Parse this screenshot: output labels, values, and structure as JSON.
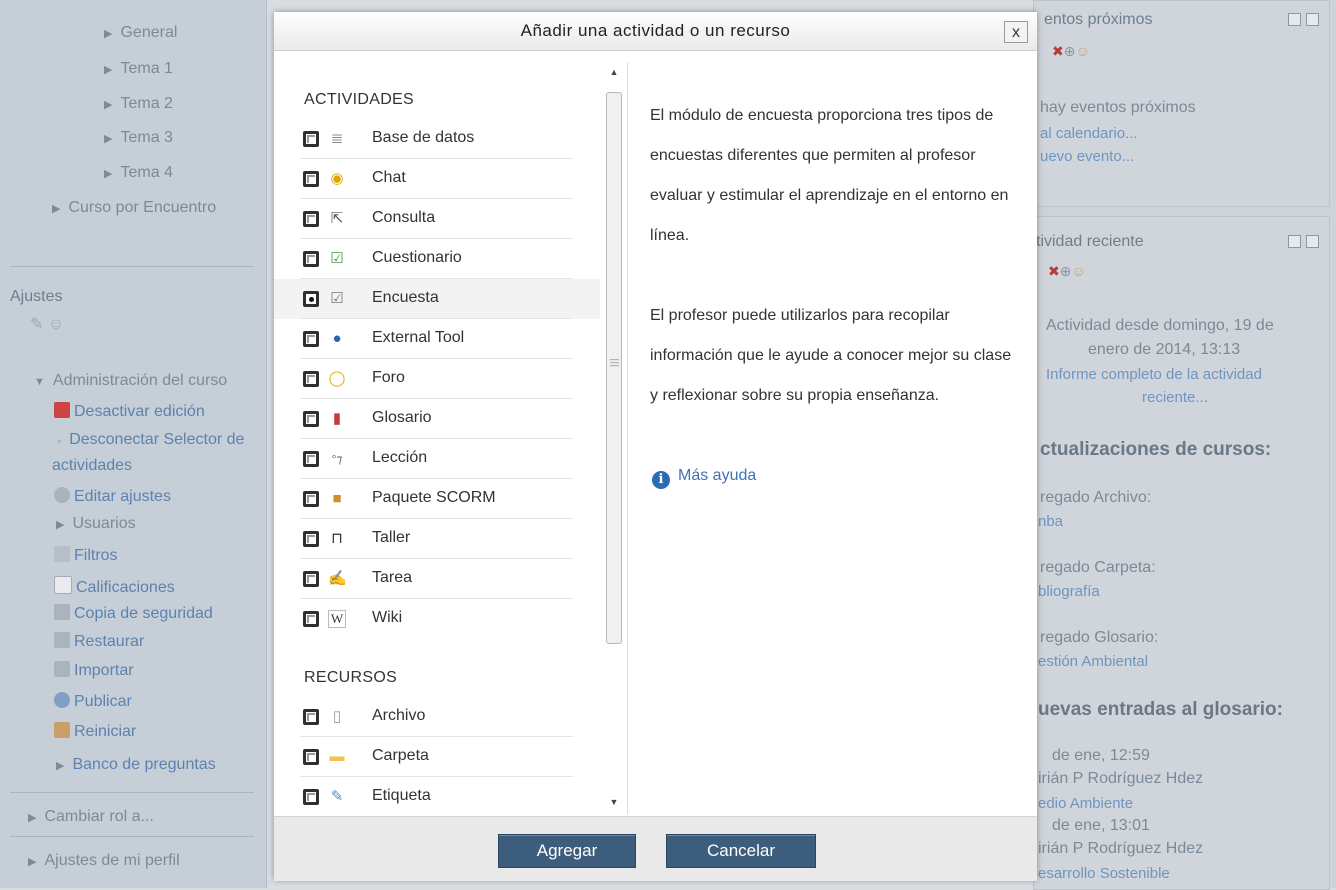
{
  "left": {
    "nav": [
      "General",
      "Tema 1",
      "Tema 2",
      "Tema 3",
      "Tema 4",
      "Curso por Encuentro"
    ],
    "settings_title": "Ajustes",
    "admin_title": "Administración del curso",
    "admin_items": [
      "Desactivar edición",
      "Desconectar Selector de",
      "actividades",
      "Editar ajustes",
      "Usuarios",
      "Filtros",
      "Calificaciones",
      "Copia de seguridad",
      "Restaurar",
      "Importar",
      "Publicar",
      "Reiniciar",
      "Banco de preguntas"
    ],
    "switch_role": "Cambiar rol a...",
    "profile_settings": "Ajustes de mi perfil"
  },
  "right": {
    "events_title": "entos próximos",
    "no_events": "hay eventos próximos",
    "calendar_link": "al calendario...",
    "new_event_link": "uevo evento...",
    "activity_title": "tividad reciente",
    "activity_since_1": "Actividad desde domingo, 19 de",
    "activity_since_2": "enero de 2014, 13:13",
    "report_link_1": "Informe completo de la actividad",
    "report_link_2": "reciente...",
    "updates_heading": "ctualizaciones de cursos:",
    "upd1_label": "regado Archivo:",
    "upd1_link": "nba",
    "upd2_label": "regado Carpeta:",
    "upd2_link": "bliografía",
    "upd3_label": "regado Glosario:",
    "upd3_link": "estión Ambiental",
    "glossary_heading": "uevas entradas al glosario:",
    "g1_date": "de ene, 12:59",
    "g1_author": "irián P Rodríguez Hdez",
    "g1_link": "edio Ambiente",
    "g2_date": "de ene, 13:01",
    "g2_author": "irián P Rodríguez Hdez",
    "g2_link": "esarrollo Sostenible"
  },
  "modal": {
    "title": "Añadir una actividad o un recurso",
    "close": "x",
    "activities_heading": "ACTIVIDADES",
    "activities": [
      {
        "label": "Base de datos",
        "icon": "database-icon"
      },
      {
        "label": "Chat",
        "icon": "chat-icon"
      },
      {
        "label": "Consulta",
        "icon": "choice-icon"
      },
      {
        "label": "Cuestionario",
        "icon": "quiz-icon"
      },
      {
        "label": "Encuesta",
        "icon": "survey-icon",
        "selected": true
      },
      {
        "label": "External Tool",
        "icon": "globe-icon"
      },
      {
        "label": "Foro",
        "icon": "forum-icon"
      },
      {
        "label": "Glosario",
        "icon": "glossary-icon"
      },
      {
        "label": "Lección",
        "icon": "lesson-icon"
      },
      {
        "label": "Paquete SCORM",
        "icon": "scorm-icon"
      },
      {
        "label": "Taller",
        "icon": "workshop-icon"
      },
      {
        "label": "Tarea",
        "icon": "assignment-icon"
      },
      {
        "label": "Wiki",
        "icon": "wiki-icon"
      }
    ],
    "resources_heading": "RECURSOS",
    "resources": [
      {
        "label": "Archivo",
        "icon": "file-icon"
      },
      {
        "label": "Carpeta",
        "icon": "folder-icon"
      },
      {
        "label": "Etiqueta",
        "icon": "label-icon"
      }
    ],
    "description": [
      "El módulo de encuesta proporciona tres tipos de encuestas diferentes que permiten al profesor evaluar y estimular el aprendizaje en el entorno en línea.",
      "El profesor puede utilizarlos para recopilar información que le ayude a conocer mejor su clase y reflexionar sobre su propia enseñanza."
    ],
    "more_help": "Más ayuda",
    "add_button": "Agregar",
    "cancel_button": "Cancelar"
  }
}
